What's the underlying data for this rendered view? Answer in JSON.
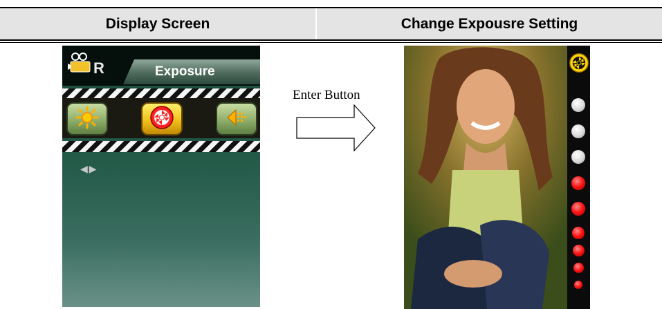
{
  "table": {
    "col1_header": "Display Screen",
    "col2_header": "Change Expousre Setting"
  },
  "menu_screen": {
    "mode_label": "R",
    "tab_label": "Exposure",
    "icons": [
      "brightness-icon",
      "exposure-aperture-icon",
      "metering-icon"
    ],
    "selected_icon": "exposure-aperture-icon"
  },
  "middle": {
    "action_label": "Enter Button"
  },
  "exposure_scale": {
    "top_icon": "exposure-aperture-icon",
    "levels": [
      "white",
      "white",
      "white",
      "red",
      "red",
      "red",
      "red",
      "red",
      "red"
    ]
  }
}
